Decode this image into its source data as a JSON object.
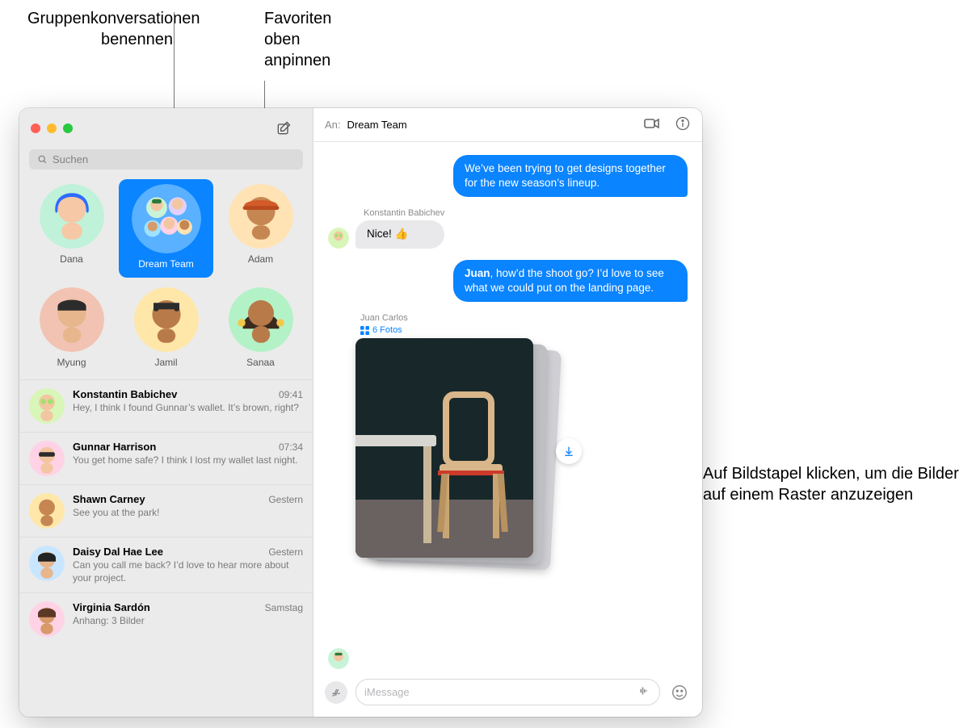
{
  "callouts": {
    "name_groups": "Gruppenkonversationen benennen",
    "pin_fav": "Favoriten oben anpinnen",
    "stack": "Auf Bildstapel klicken, um die Bilder auf einem Raster anzuzeigen"
  },
  "search": {
    "placeholder": "Suchen"
  },
  "pins": [
    {
      "name": "Dana"
    },
    {
      "name": "Dream Team",
      "selected": true
    },
    {
      "name": "Adam"
    },
    {
      "name": "Myung"
    },
    {
      "name": "Jamil"
    },
    {
      "name": "Sanaa"
    }
  ],
  "conversations": [
    {
      "name": "Konstantin Babichev",
      "time": "09:41",
      "preview": "Hey, I think I found Gunnar’s wallet. It’s brown, right?"
    },
    {
      "name": "Gunnar Harrison",
      "time": "07:34",
      "preview": "You get home safe? I think I lost my wallet last night."
    },
    {
      "name": "Shawn Carney",
      "time": "Gestern",
      "preview": "See you at the park!"
    },
    {
      "name": "Daisy Dal Hae Lee",
      "time": "Gestern",
      "preview": "Can you call me back? I’d love to hear more about your project."
    },
    {
      "name": "Virginia Sardón",
      "time": "Samstag",
      "preview": "Anhang: 3 Bilder"
    }
  ],
  "chat": {
    "to_label": "An:",
    "to_name": "Dream Team",
    "m1": "We’ve been trying to get designs together for the new season’s lineup.",
    "m2_sender": "Konstantin Babichev",
    "m2": "Nice! 👍",
    "m3_pre": "Juan",
    "m3": ", how’d the shoot go? I’d love to see what we could put on the landing page.",
    "photos_sender": "Juan Carlos",
    "photos_label": "6 Fotos"
  },
  "composer": {
    "placeholder": "iMessage"
  }
}
